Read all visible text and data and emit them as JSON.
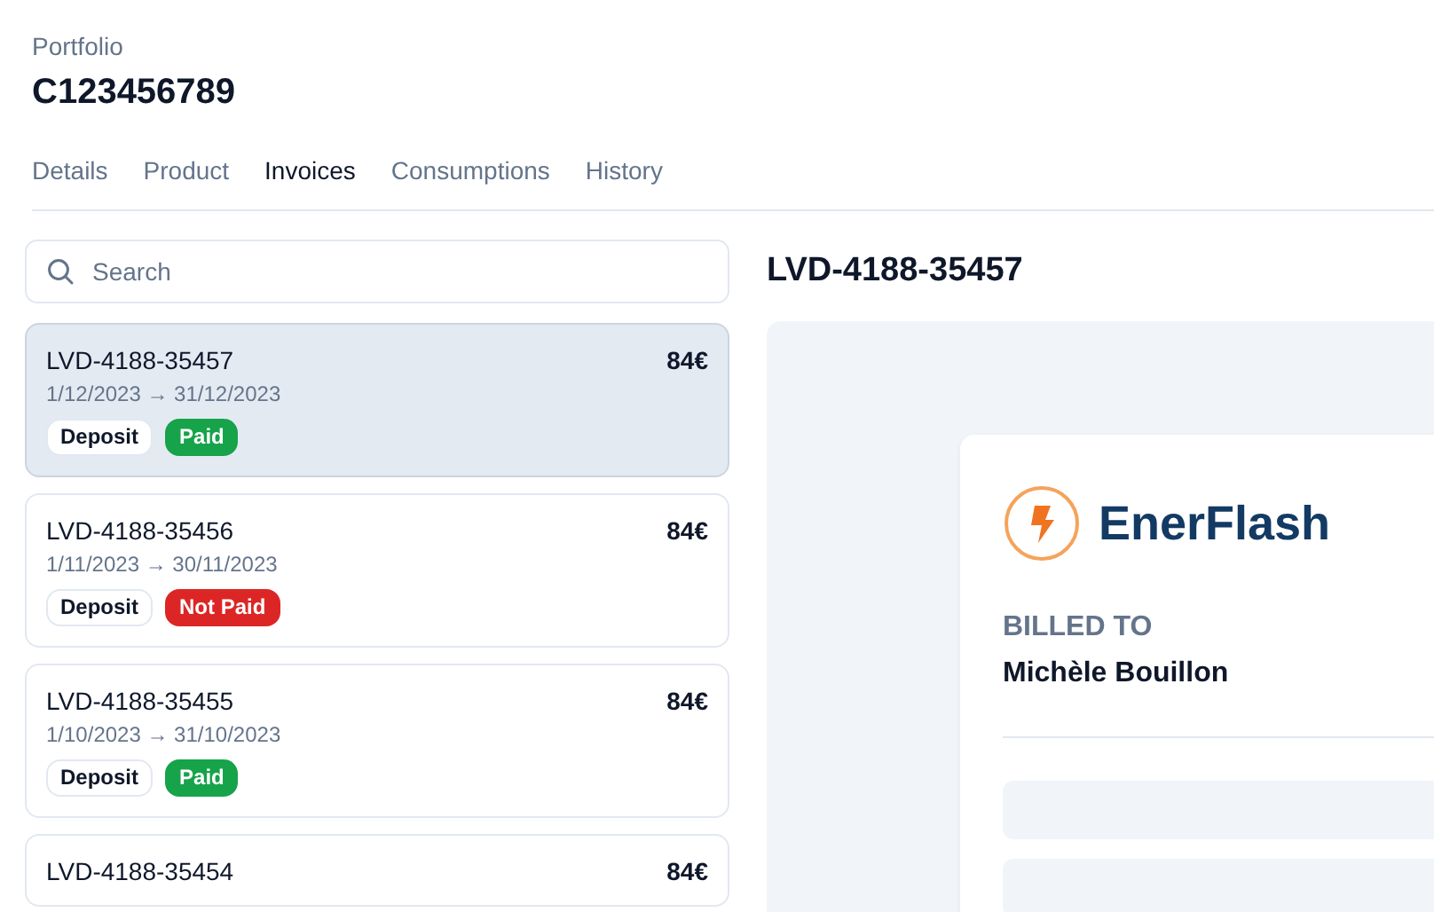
{
  "header": {
    "label": "Portfolio",
    "title": "C123456789"
  },
  "tabs": [
    {
      "label": "Details",
      "selected": false
    },
    {
      "label": "Product",
      "selected": false
    },
    {
      "label": "Invoices",
      "selected": true
    },
    {
      "label": "Consumptions",
      "selected": false
    },
    {
      "label": "History",
      "selected": false
    }
  ],
  "search": {
    "placeholder": "Search"
  },
  "invoices": [
    {
      "number": "LVD-4188-35457",
      "amount": "84€",
      "period": "1/12/2023 → 31/12/2023",
      "selected": true,
      "tags": [
        {
          "label": "Deposit",
          "kind": "outline"
        },
        {
          "label": "Paid",
          "kind": "success"
        }
      ]
    },
    {
      "number": "LVD-4188-35456",
      "amount": "84€",
      "period": "1/11/2023 → 30/11/2023",
      "selected": false,
      "tags": [
        {
          "label": "Deposit",
          "kind": "outline"
        },
        {
          "label": "Not Paid",
          "kind": "danger"
        }
      ]
    },
    {
      "number": "LVD-4188-35455",
      "amount": "84€",
      "period": "1/10/2023 → 31/10/2023",
      "selected": false,
      "tags": [
        {
          "label": "Deposit",
          "kind": "outline"
        },
        {
          "label": "Paid",
          "kind": "success"
        }
      ]
    },
    {
      "number": "LVD-4188-35454",
      "amount": "84€",
      "selected": false
    }
  ],
  "preview": {
    "title": "LVD-4188-35457",
    "brand": "EnerFlash",
    "billed_to_label": "BILLED TO",
    "billed_to_name": "Michèle Bouillon"
  }
}
